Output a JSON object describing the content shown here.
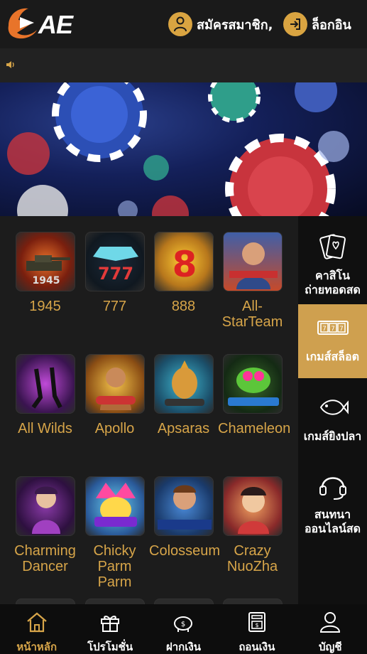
{
  "header": {
    "logo_text": "AE",
    "register_label": "สมัครสมาชิก,",
    "login_label": "ล็อกอิน"
  },
  "colors": {
    "accent": "#d7a549",
    "accent_bg": "#cfa04f",
    "background": "#1c1c1c",
    "sidebar": "#101010"
  },
  "games": [
    {
      "name": "1945",
      "icon": "tank-icon"
    },
    {
      "name": "777",
      "icon": "diamond-777-icon"
    },
    {
      "name": "888",
      "icon": "red-8-icon"
    },
    {
      "name": "All-StarTeam",
      "icon": "soccer-player-icon"
    },
    {
      "name": "All Wilds",
      "icon": "dancers-icon"
    },
    {
      "name": "Apollo",
      "icon": "apollo-icon"
    },
    {
      "name": "Apsaras",
      "icon": "buddha-icon"
    },
    {
      "name": "Chameleon",
      "icon": "chameleon-icon"
    },
    {
      "name": "Charming Dancer",
      "icon": "dancer-icon"
    },
    {
      "name": "Chicky Parm Parm",
      "icon": "chicky-icon"
    },
    {
      "name": "Colosseum",
      "icon": "colosseum-icon"
    },
    {
      "name": "Crazy NuoZha",
      "icon": "nuozha-icon"
    }
  ],
  "sidebar": {
    "items": [
      {
        "label": "คาสิโน ถ่ายทอดสด",
        "icon": "cards-icon",
        "active": false
      },
      {
        "label": "เกมส์สล็อต",
        "icon": "slot-icon",
        "active": true
      },
      {
        "label": "เกมส์ยิงปลา",
        "icon": "fish-icon",
        "active": false
      },
      {
        "label": "สนทนา ออนไลน์สด",
        "icon": "headset-icon",
        "active": false
      }
    ]
  },
  "bottom_nav": {
    "items": [
      {
        "label": "หน้าหลัก",
        "icon": "home-icon",
        "active": true
      },
      {
        "label": "โปรโมชั่น",
        "icon": "gift-icon",
        "active": false
      },
      {
        "label": "ฝากเงิน",
        "icon": "piggy-bank-icon",
        "active": false
      },
      {
        "label": "ถอนเงิน",
        "icon": "atm-icon",
        "active": false
      },
      {
        "label": "บัญชี",
        "icon": "user-icon",
        "active": false
      }
    ]
  }
}
